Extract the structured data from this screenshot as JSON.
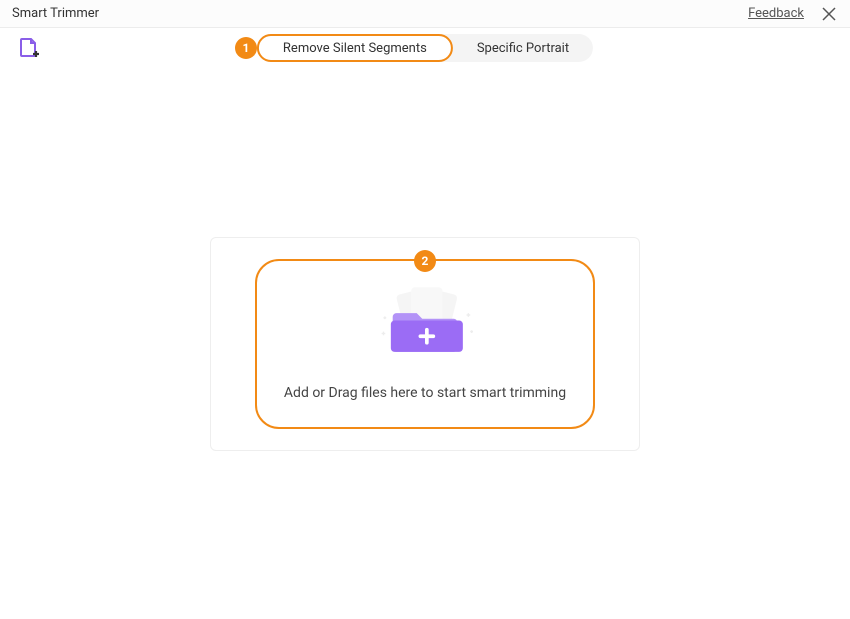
{
  "window": {
    "title": "Smart Trimmer",
    "feedback": "Feedback"
  },
  "tabs": [
    {
      "label": "Remove Silent Segments",
      "active": true
    },
    {
      "label": "Specific Portrait",
      "active": false
    }
  ],
  "steps": {
    "one": "1",
    "two": "2"
  },
  "dropzone": {
    "text": "Add or Drag files here to start smart trimming"
  },
  "colors": {
    "accent": "#f28a15",
    "folder": "#9b6cf5"
  }
}
